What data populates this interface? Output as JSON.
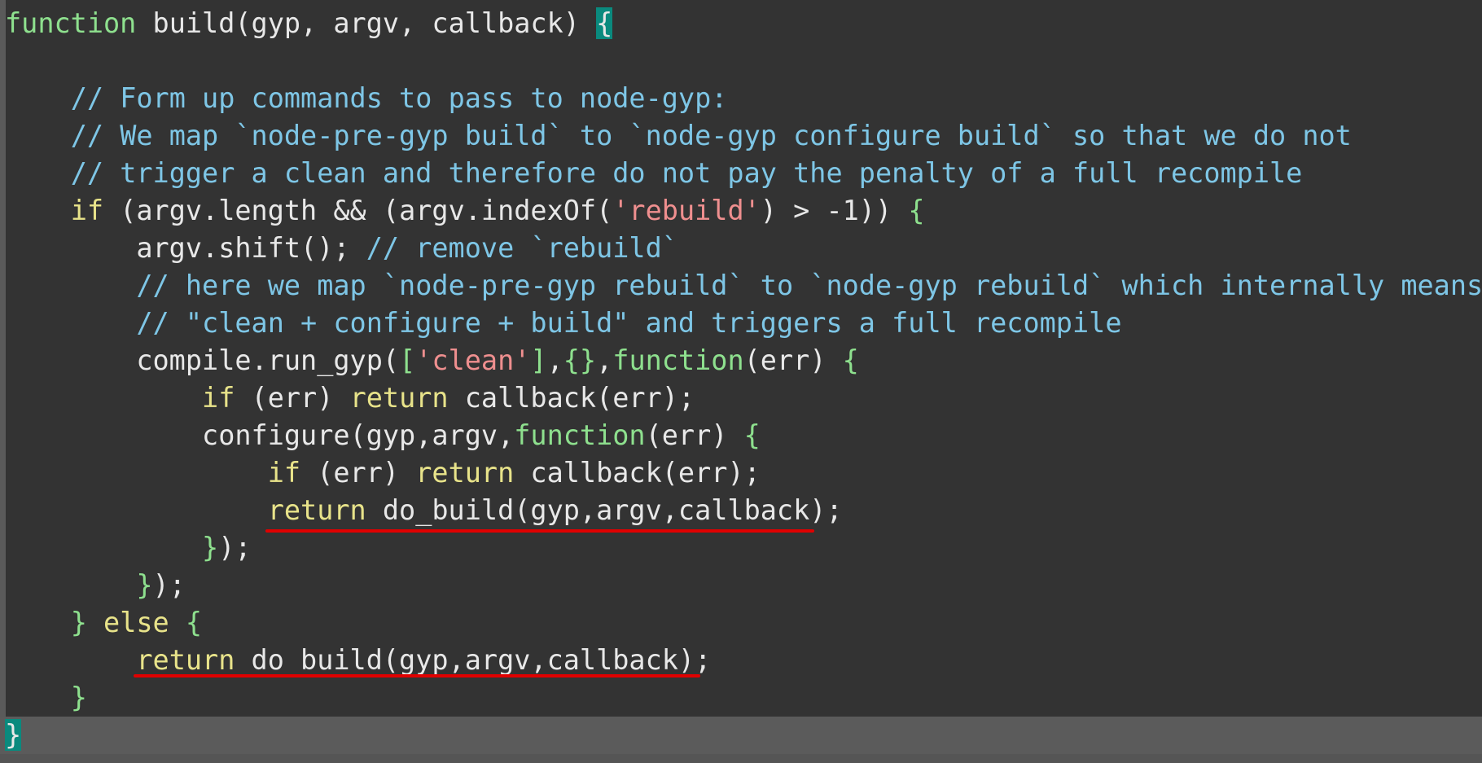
{
  "lines": [
    [
      [
        "fn",
        "function"
      ],
      [
        "plain",
        " build(gyp, argv, callback) "
      ],
      [
        "brace",
        "{"
      ]
    ],
    [],
    [
      [
        "plain",
        "    "
      ],
      [
        "cm",
        "// Form up commands to pass to node-gyp:"
      ]
    ],
    [
      [
        "plain",
        "    "
      ],
      [
        "cm",
        "// We map `node-pre-gyp build` to `node-gyp configure build` so that we do not"
      ]
    ],
    [
      [
        "plain",
        "    "
      ],
      [
        "cm",
        "// trigger a clean and therefore do not pay the penalty of a full recompile"
      ]
    ],
    [
      [
        "plain",
        "    "
      ],
      [
        "kw",
        "if"
      ],
      [
        "plain",
        " (argv.length && (argv.indexOf("
      ],
      [
        "str",
        "'rebuild'"
      ],
      [
        "plain",
        ") > -1)) "
      ],
      [
        "br",
        "{"
      ]
    ],
    [
      [
        "plain",
        "        argv.shift(); "
      ],
      [
        "cm",
        "// remove `rebuild`"
      ]
    ],
    [
      [
        "plain",
        "        "
      ],
      [
        "cm",
        "// here we map `node-pre-gyp rebuild` to `node-gyp rebuild` which internally means"
      ]
    ],
    [
      [
        "plain",
        "        "
      ],
      [
        "cm",
        "// \"clean + configure + build\" and triggers a full recompile"
      ]
    ],
    [
      [
        "plain",
        "        compile.run_gyp("
      ],
      [
        "br",
        "["
      ],
      [
        "str",
        "'clean'"
      ],
      [
        "br",
        "]"
      ],
      [
        "plain",
        ","
      ],
      [
        "br",
        "{}"
      ],
      [
        "plain",
        ","
      ],
      [
        "fn",
        "function"
      ],
      [
        "plain",
        "(err) "
      ],
      [
        "br",
        "{"
      ]
    ],
    [
      [
        "plain",
        "            "
      ],
      [
        "kw",
        "if"
      ],
      [
        "plain",
        " (err) "
      ],
      [
        "kw",
        "return"
      ],
      [
        "plain",
        " callback(err);"
      ]
    ],
    [
      [
        "plain",
        "            configure(gyp,argv,"
      ],
      [
        "fn",
        "function"
      ],
      [
        "plain",
        "(err) "
      ],
      [
        "br",
        "{"
      ]
    ],
    [
      [
        "plain",
        "                "
      ],
      [
        "kw",
        "if"
      ],
      [
        "plain",
        " (err) "
      ],
      [
        "kw",
        "return"
      ],
      [
        "plain",
        " callback(err);"
      ]
    ],
    [
      [
        "plain",
        "                "
      ],
      [
        "kw",
        "return"
      ],
      [
        "plain",
        " do_build(gyp,argv,callback);"
      ]
    ],
    [
      [
        "plain",
        "            "
      ],
      [
        "br",
        "}"
      ],
      [
        "plain",
        ");"
      ]
    ],
    [
      [
        "plain",
        "        "
      ],
      [
        "br",
        "}"
      ],
      [
        "plain",
        ");"
      ]
    ],
    [
      [
        "plain",
        "    "
      ],
      [
        "br",
        "}"
      ],
      [
        "plain",
        " "
      ],
      [
        "kw",
        "else"
      ],
      [
        "plain",
        " "
      ],
      [
        "br",
        "{"
      ]
    ],
    [
      [
        "plain",
        "        "
      ],
      [
        "kw",
        "return"
      ],
      [
        "plain",
        " do_build(gyp,argv,callback);"
      ]
    ],
    [
      [
        "plain",
        "    "
      ],
      [
        "br",
        "}"
      ]
    ],
    [
      [
        "brace",
        "}"
      ]
    ]
  ],
  "current_line": 19,
  "colors": {
    "background": "#333333",
    "keyword": "#e8e38a",
    "function_keyword": "#8ee08e",
    "comment": "#7ec6e6",
    "string": "#ef8f8f",
    "brace_match_bg": "#0a8a7e",
    "underline": "#e00000"
  },
  "annotations": [
    {
      "type": "red-underline",
      "line": 13,
      "text": "return do_build(gyp,argv,callback)"
    },
    {
      "type": "red-underline",
      "line": 17,
      "text": "return do_build(gyp,argv,callback);"
    }
  ]
}
